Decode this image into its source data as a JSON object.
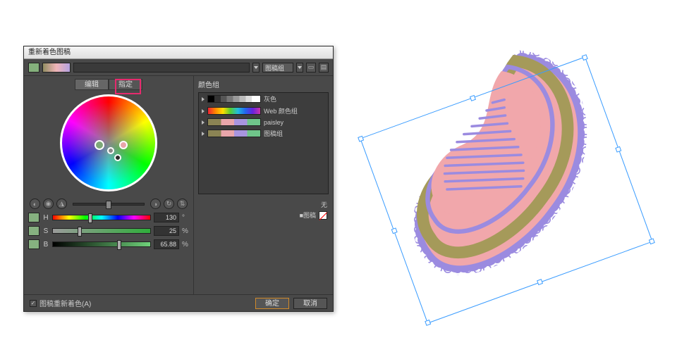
{
  "dialog": {
    "title": "重新着色图稿",
    "top_swatch": "#84b07c",
    "group_selected": "图稿组",
    "tabs": {
      "edit": "编辑",
      "assign": "指定",
      "active": "edit"
    },
    "modes": {
      "left_icons": [
        "◐",
        "◉",
        "◮"
      ],
      "right_icons": [
        "◑",
        "↻",
        "⇅"
      ]
    },
    "hsb": {
      "rows": [
        {
          "label": "H",
          "value": "130",
          "unit": "°",
          "swatch": "#86b180",
          "track_css": "linear-gradient(90deg,#ff0000,#ffff00,#00ff00,#00ffff,#0000ff,#ff00ff,#ff0000)",
          "knob_pct": 36
        },
        {
          "label": "S",
          "value": "25",
          "unit": "%",
          "swatch": "#86b180",
          "track_css": "linear-gradient(90deg,#9a9a9a,#2fae3b)",
          "knob_pct": 25
        },
        {
          "label": "B",
          "value": "65.88",
          "unit": "%",
          "swatch": "#86b180",
          "track_css": "linear-gradient(90deg,#000000,#6fd27a)",
          "knob_pct": 66
        }
      ]
    },
    "none_label": "无",
    "recolor_label": "■图稿",
    "groups_title": "颜色组",
    "groups": [
      {
        "name": "灰色",
        "strip_css": "linear-gradient(90deg,#000 0 12%,#333 12% 24%,#555 24% 36%,#777 36% 48%,#999 48% 60%,#bbb 60% 72%,#ddd 72% 84%,#fff 84% 100%)"
      },
      {
        "name": "Web 颜色组",
        "strip_css": "linear-gradient(90deg,#e23,#f80,#fd0,#5c3,#2bd,#26e,#62d,#c3a)"
      },
      {
        "name": "paisley",
        "strip_css": "linear-gradient(90deg,#8b8454 0 25%,#e9a6aa 25% 50%,#a895df 50% 75%,#6fc58a 75% 100%)"
      },
      {
        "name": "图稿组",
        "strip_css": "linear-gradient(90deg,#8b8454 0 25%,#e9a6aa 25% 50%,#a895df 50% 75%,#6fc58a 75% 100%)"
      }
    ],
    "checkbox_label": "图稿重新着色(A)",
    "ok_label": "确定",
    "cancel_label": "取消"
  },
  "wheel_handles": [
    {
      "left_pct": 40,
      "top_pct": 52,
      "color": "#7da878",
      "size": 14
    },
    {
      "left_pct": 52,
      "top_pct": 58,
      "color": "#888888",
      "size": 10
    },
    {
      "left_pct": 60,
      "top_pct": 66,
      "color": "#2b2b2b",
      "size": 10
    },
    {
      "left_pct": 66,
      "top_pct": 52,
      "color": "#e9a6aa",
      "size": 12
    }
  ],
  "art": {
    "palette": {
      "olive": "#a59a5a",
      "pink": "#f1a7ab",
      "violet": "#9b8be0"
    }
  },
  "chart_data": null
}
